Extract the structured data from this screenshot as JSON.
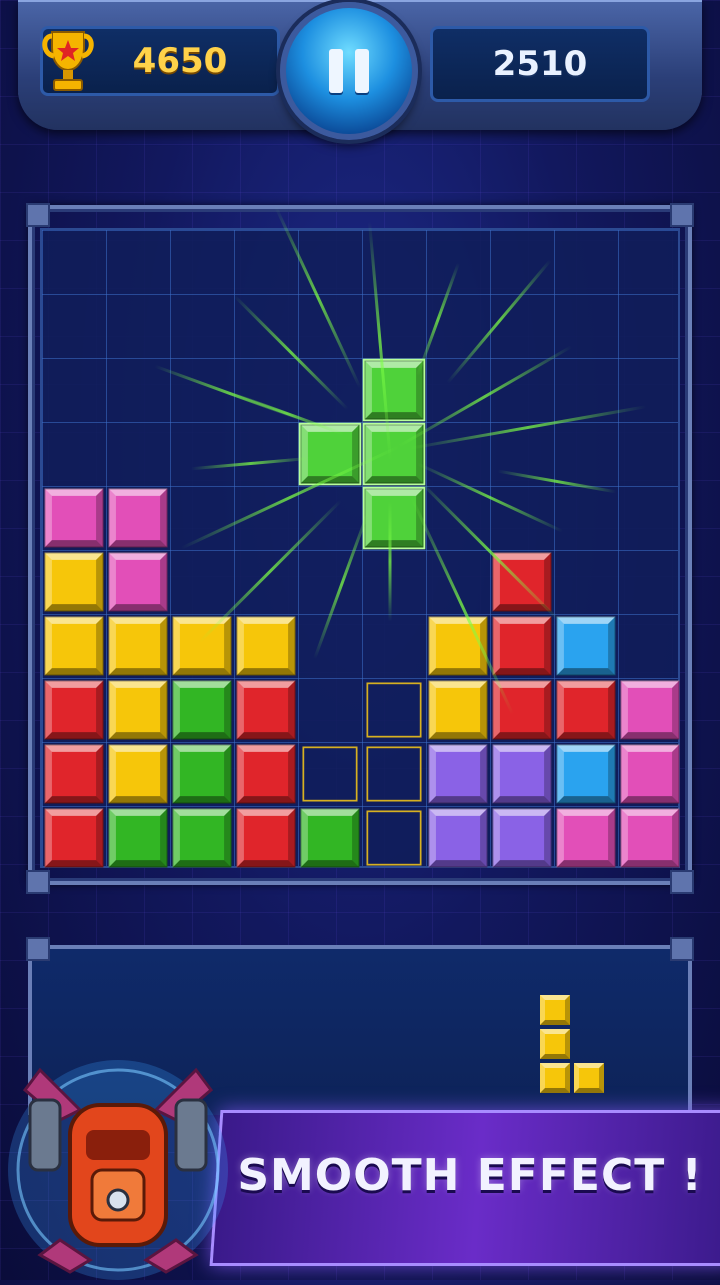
{
  "header": {
    "best_score": "4650",
    "current_score": "2510",
    "pause_label": "pause"
  },
  "board": {
    "columns": 10,
    "rows": 10,
    "colors": {
      "M": "#e24fb8",
      "Y": "#f6c60a",
      "R": "#e0252b",
      "G": "#32b624",
      "B": "#2aa3ef",
      "P": "#8a62e6"
    },
    "grid": [
      "..........",
      "..........",
      "..........",
      "..........",
      "MM........",
      "YM.....R..",
      "YYYY..YRB.",
      "RYGR..YRRM",
      "RYGR..PPBM",
      "RGGRG.PPMM"
    ],
    "active_piece": {
      "color": "#4fd23a",
      "cells": [
        [
          5,
          2
        ],
        [
          4,
          3
        ],
        [
          5,
          3
        ],
        [
          5,
          4
        ]
      ]
    },
    "ghost_piece": {
      "color": "#d6b021",
      "cells": [
        [
          5,
          7
        ],
        [
          4,
          8
        ],
        [
          5,
          8
        ],
        [
          5,
          9
        ]
      ]
    }
  },
  "next_piece": {
    "color": "#f6c60a",
    "cells": [
      [
        0,
        0
      ],
      [
        0,
        1
      ],
      [
        0,
        2
      ],
      [
        1,
        2
      ]
    ]
  },
  "banner": {
    "text": "SMOOTH EFFECT !"
  },
  "icons": {
    "trophy": "trophy-icon",
    "pause": "pause-icon",
    "mascot": "robot-mascot"
  }
}
